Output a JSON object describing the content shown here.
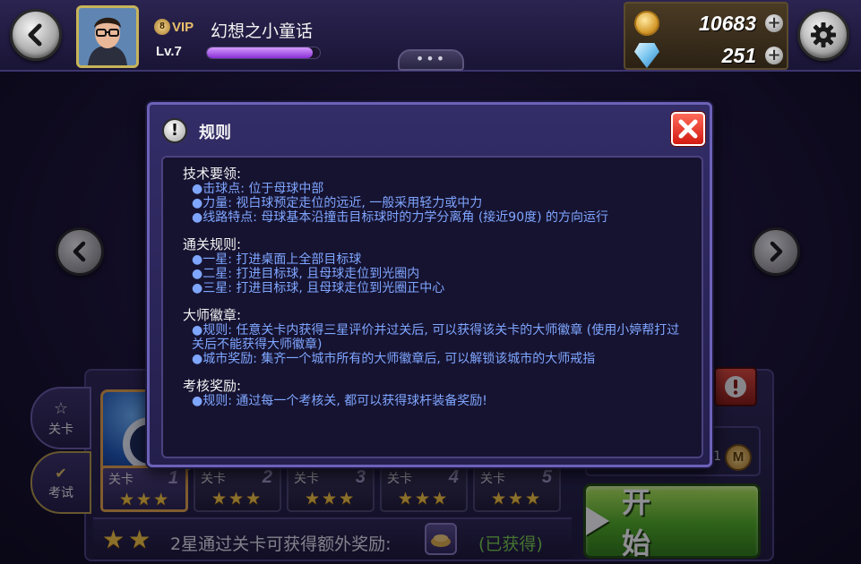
{
  "header": {
    "vip_label": "VIP",
    "vip_level_digit": "8",
    "player_name": "幻想之小童话",
    "level_label": "Lv.7",
    "xp_progress_pct": 94,
    "more_label": "•••",
    "coins": "10683",
    "gems": "251"
  },
  "modal": {
    "title": "规则",
    "sections": [
      {
        "title": "技术要领:",
        "lines": [
          "●击球点: 位于母球中部",
          "●力量: 视白球预定走位的远近, 一般采用轻力或中力",
          "●线路特点: 母球基本沿撞击目标球时的力学分离角 (接近90度) 的方向运行"
        ]
      },
      {
        "title": "通关规则:",
        "lines": [
          "●一星: 打进桌面上全部目标球",
          "●二星: 打进目标球, 且母球走位到光圈内",
          "●三星: 打进目标球, 且母球走位到光圈正中心"
        ]
      },
      {
        "title": "大师徽章:",
        "lines": [
          "●规则: 任意关卡内获得三星评价并过关后, 可以获得该关卡的大师徽章 (使用小婷帮打过关后不能获得大师徽章)",
          "●城市奖励: 集齐一个城市所有的大师徽章后, 可以解锁该城市的大师戒指"
        ]
      },
      {
        "title": "考核奖励:",
        "lines": [
          "●规则: 通过每一个考核关, 都可以获得球杆装备奖励!"
        ]
      }
    ]
  },
  "side_tabs": {
    "stages": "关卡",
    "exam": "考试"
  },
  "levels": [
    {
      "label": "关卡",
      "num": "1",
      "stars": "★★★",
      "active": true
    },
    {
      "label": "关卡",
      "num": "2",
      "stars": "★★★",
      "active": false
    },
    {
      "label": "关卡",
      "num": "3",
      "stars": "★★★",
      "active": false
    },
    {
      "label": "关卡",
      "num": "4",
      "stars": "★★★",
      "active": false
    },
    {
      "label": "关卡",
      "num": "5",
      "stars": "★★★",
      "active": false
    }
  ],
  "reward": {
    "stars": "★★",
    "text": "2星通过关卡可获得额外奖励:",
    "status": "(已获得)"
  },
  "medal": {
    "count": "1",
    "icon_letter": "M"
  },
  "start_button": {
    "label": "开 始"
  },
  "colors": {
    "rule_text": "#7fa6ff",
    "start_green": "#4fae22",
    "close_red": "#d21a10",
    "reward_status": "#78d04b"
  }
}
